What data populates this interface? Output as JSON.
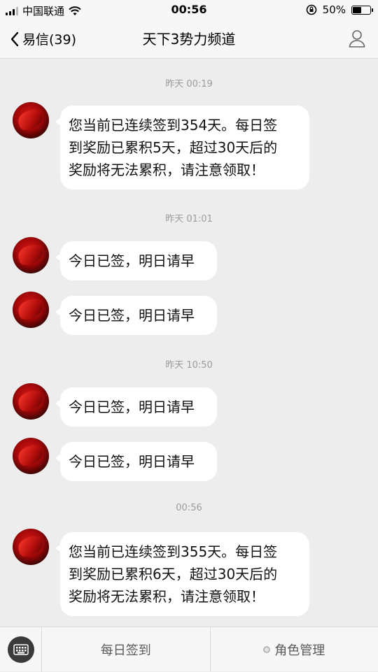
{
  "status_bar": {
    "carrier": "中国联通",
    "time": "00:56",
    "battery": "50%",
    "battery_level": 0.5
  },
  "nav": {
    "back_label": "易信(39)",
    "title": "天下3势力频道"
  },
  "messages": {
    "ts1": "昨天 00:19",
    "m1": {
      "line1": "您当前已连续签到354天。每日签",
      "line2": "到奖励已累积5天，超过30天后的",
      "line3": "奖励将无法累积，请注意领取！"
    },
    "ts2": "昨天 01:01",
    "m2": "今日已签，明日请早",
    "m3": "今日已签，明日请早",
    "ts3": "昨天 10:50",
    "m4": "今日已签，明日请早",
    "m5": "今日已签，明日请早",
    "ts4": "00:56",
    "m6": {
      "line1": "您当前已连续签到355天。每日签",
      "line2": "到奖励已累积6天，超过30天后的",
      "line3": "奖励将无法累积，请注意领取！"
    }
  },
  "bottom_bar": {
    "daily_signin": "每日签到",
    "role_manage": "角色管理"
  },
  "icons": {
    "back": "chevron-left-icon",
    "profile": "person-icon",
    "keyboard": "keyboard-icon",
    "wifi": "wifi-icon",
    "rotation_lock": "rotation-lock-icon"
  }
}
